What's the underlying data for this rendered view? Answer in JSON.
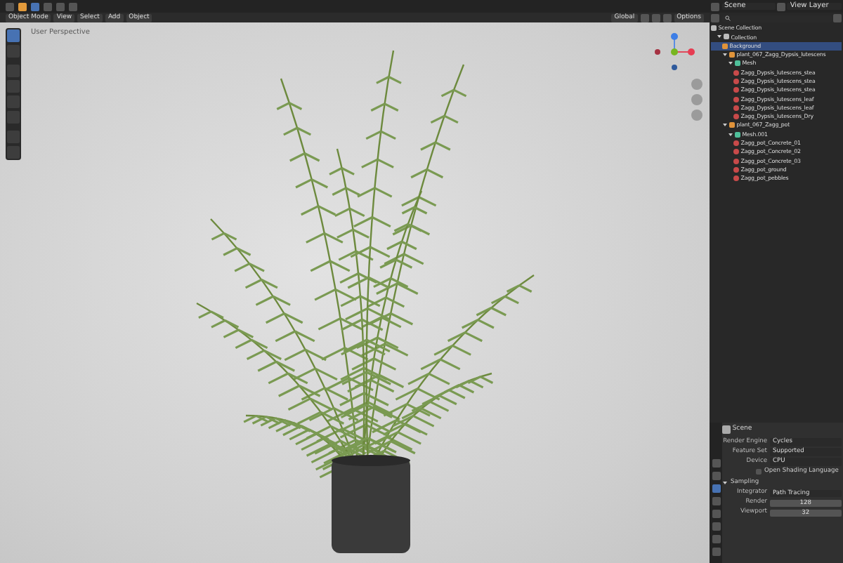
{
  "top_bar": {
    "scene": "Scene",
    "view_layer": "View Layer"
  },
  "viewport": {
    "mode": "Object Mode",
    "menus": [
      "View",
      "Select",
      "Add",
      "Object"
    ],
    "transform": "Global",
    "options": "Options",
    "overlay_text": "User Perspective",
    "tools": [
      {
        "selected": true
      },
      {
        "selected": false
      },
      {
        "selected": false
      },
      {
        "selected": false
      },
      {
        "selected": false
      },
      {
        "selected": false
      },
      {
        "selected": false
      },
      {
        "selected": false
      }
    ]
  },
  "outliner": {
    "root": "Scene Collection",
    "items": [
      {
        "label": "Collection",
        "kind": "collection",
        "selected": false,
        "expanded": true,
        "children": [
          {
            "label": "Background",
            "kind": "object",
            "selected": true
          },
          {
            "label": "plant_067_Zagg_Dypsis_lutescens",
            "kind": "object",
            "selected": false,
            "expanded": true,
            "children": [
              {
                "label": "Mesh",
                "kind": "mesh",
                "selected": false,
                "expanded": true,
                "children": [
                  {
                    "label": "Zagg_Dypsis_lutescens_stea",
                    "kind": "material",
                    "selected": false
                  },
                  {
                    "label": "Zagg_Dypsis_lutescens_stea",
                    "kind": "material",
                    "selected": false
                  },
                  {
                    "label": "Zagg_Dypsis_lutescens_stea",
                    "kind": "material",
                    "selected": false
                  },
                  {
                    "label": "Zagg_Dypsis_lutescens_leaf",
                    "kind": "material",
                    "selected": false
                  },
                  {
                    "label": "Zagg_Dypsis_lutescens_leaf",
                    "kind": "material",
                    "selected": false
                  },
                  {
                    "label": "Zagg_Dypsis_lutescens_Dry",
                    "kind": "material",
                    "selected": false
                  }
                ]
              }
            ]
          },
          {
            "label": "plant_067_Zagg_pot",
            "kind": "object",
            "selected": false,
            "expanded": true,
            "children": [
              {
                "label": "Mesh.001",
                "kind": "mesh",
                "selected": false,
                "expanded": true,
                "children": [
                  {
                    "label": "Zagg_pot_Concrete_01",
                    "kind": "material",
                    "selected": false
                  },
                  {
                    "label": "Zagg_pot_Concrete_02",
                    "kind": "material",
                    "selected": false
                  },
                  {
                    "label": "Zagg_pot_Concrete_03",
                    "kind": "material",
                    "selected": false
                  },
                  {
                    "label": "Zagg_pot_ground",
                    "kind": "material",
                    "selected": false
                  },
                  {
                    "label": "Zagg_pot_pebbles",
                    "kind": "material",
                    "selected": false
                  }
                ]
              }
            ]
          }
        ]
      }
    ]
  },
  "properties": {
    "title": "Scene",
    "fields": [
      {
        "kind": "dropdown",
        "label": "Render Engine",
        "value": "Cycles"
      },
      {
        "kind": "dropdown",
        "label": "Feature Set",
        "value": "Supported"
      },
      {
        "kind": "dropdown",
        "label": "Device",
        "value": "CPU"
      },
      {
        "kind": "checkbox",
        "label": "Open Shading Language",
        "checked": false
      }
    ],
    "section": {
      "label": "Sampling",
      "expanded": true,
      "fields": [
        {
          "kind": "dropdown",
          "label": "Integrator",
          "value": "Path Tracing"
        },
        {
          "kind": "number",
          "label": "Render",
          "value": "128"
        },
        {
          "kind": "number",
          "label": "Viewport",
          "value": "32"
        }
      ]
    }
  }
}
